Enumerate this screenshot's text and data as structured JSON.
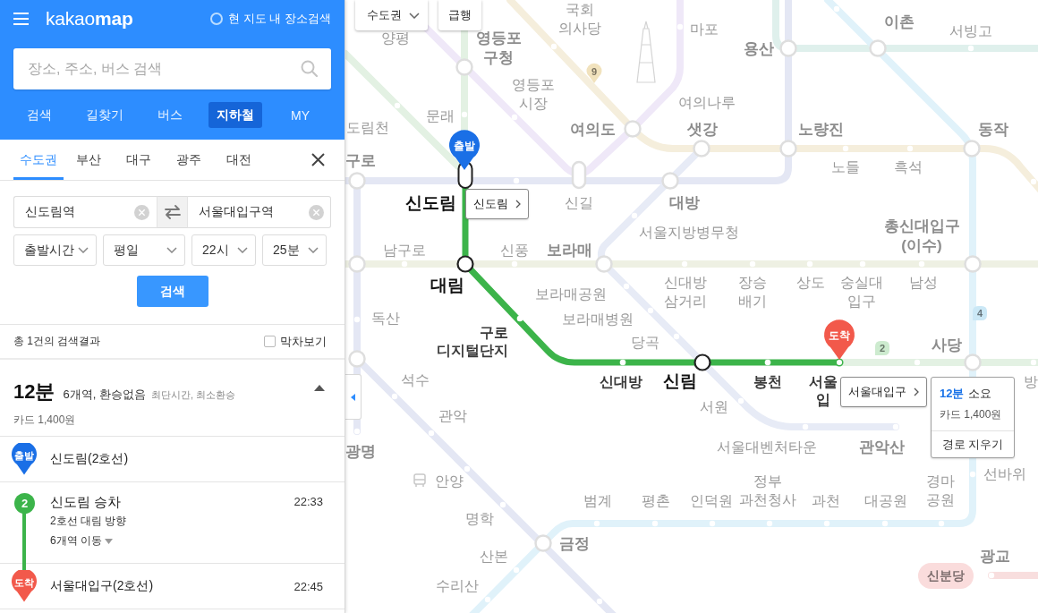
{
  "header": {
    "logo": "kakao**map**",
    "area_search": {
      "label": "현 지도 내 장소검색",
      "checked": false
    },
    "search": {
      "placeholder": "장소, 주소, 버스 검색"
    },
    "nav_tabs": [
      {
        "label": "검색",
        "selected": false
      },
      {
        "label": "길찾기",
        "selected": false
      },
      {
        "label": "버스",
        "selected": false
      },
      {
        "label": "지하철",
        "selected": true
      },
      {
        "label": "MY",
        "selected": false
      }
    ]
  },
  "region_tabs": [
    {
      "label": "수도권",
      "selected": true
    },
    {
      "label": "부산",
      "selected": false
    },
    {
      "label": "대구",
      "selected": false
    },
    {
      "label": "광주",
      "selected": false
    },
    {
      "label": "대전",
      "selected": false
    }
  ],
  "route_form": {
    "origin": "신도림역",
    "destination": "서울대입구역",
    "selects": [
      "출발시간",
      "평일",
      "22시",
      "25분"
    ],
    "search_button": "검색"
  },
  "results_bar": {
    "count": "총 1건의 검색결과",
    "last_train": {
      "label": "막차보기",
      "checked": false
    }
  },
  "result": {
    "duration": "12분",
    "summary": "6개역, 환승없음",
    "tags": "최단시간, 최소환승",
    "fare": "카드 1,400원",
    "expanded": true,
    "steps": [
      {
        "kind": "start",
        "badge": "출발",
        "title": "신도림(2호선)"
      },
      {
        "kind": "ride",
        "badge": "2",
        "title": "신도림 승차",
        "time": "22:33",
        "direction": "2호선 대림 방향",
        "stops": {
          "label": "6개역 이동",
          "expanded": false
        }
      },
      {
        "kind": "end",
        "badge": "도착",
        "title": "서울대입구(2호선)",
        "time": "22:45"
      }
    ]
  },
  "map": {
    "region_select": "수도권",
    "express_button": "급행",
    "labels": [
      {
        "text": "양평",
        "kind": "station"
      },
      {
        "text": "영등포 구청",
        "kind": "transfer"
      },
      {
        "text": "국회 의사당",
        "kind": "station"
      },
      {
        "text": "마포",
        "kind": "station"
      },
      {
        "text": "용산",
        "kind": "transfer"
      },
      {
        "text": "이촌",
        "kind": "transfer"
      },
      {
        "text": "서빙고",
        "kind": "station"
      },
      {
        "text": "도림천",
        "kind": "station"
      },
      {
        "text": "문래",
        "kind": "station"
      },
      {
        "text": "영등포 시장",
        "kind": "station"
      },
      {
        "text": "여의나루",
        "kind": "station"
      },
      {
        "text": "여의도",
        "kind": "transfer"
      },
      {
        "text": "샛강",
        "kind": "transfer"
      },
      {
        "text": "노량진",
        "kind": "transfer"
      },
      {
        "text": "동작",
        "kind": "transfer"
      },
      {
        "text": "구로",
        "kind": "transfer"
      },
      {
        "text": "노들",
        "kind": "station"
      },
      {
        "text": "흑석",
        "kind": "station"
      },
      {
        "text": "신도림",
        "kind": "route-major"
      },
      {
        "text": "신길",
        "kind": "station"
      },
      {
        "text": "대방",
        "kind": "transfer"
      },
      {
        "text": "남구로",
        "kind": "station"
      },
      {
        "text": "신풍",
        "kind": "station"
      },
      {
        "text": "보라매",
        "kind": "transfer"
      },
      {
        "text": "서울지방병무청",
        "kind": "station"
      },
      {
        "text": "총신대입구 (이수)",
        "kind": "transfer"
      },
      {
        "text": "대림",
        "kind": "route-major"
      },
      {
        "text": "보라매공원",
        "kind": "station"
      },
      {
        "text": "독산",
        "kind": "station"
      },
      {
        "text": "구로 디지털단지",
        "kind": "route"
      },
      {
        "text": "보라매병원",
        "kind": "station"
      },
      {
        "text": "신대방 삼거리",
        "kind": "station"
      },
      {
        "text": "장승 배기",
        "kind": "station"
      },
      {
        "text": "상도",
        "kind": "station"
      },
      {
        "text": "숭실대 입구",
        "kind": "station"
      },
      {
        "text": "남성",
        "kind": "station"
      },
      {
        "text": "당곡",
        "kind": "station"
      },
      {
        "text": "사당",
        "kind": "transfer"
      },
      {
        "text": "석수",
        "kind": "station"
      },
      {
        "text": "관악",
        "kind": "station"
      },
      {
        "text": "신대방",
        "kind": "route"
      },
      {
        "text": "신림",
        "kind": "route-major"
      },
      {
        "text": "서원",
        "kind": "station"
      },
      {
        "text": "봉천",
        "kind": "route"
      },
      {
        "text": "서울 입",
        "kind": "route"
      },
      {
        "text": "방",
        "kind": "station"
      },
      {
        "text": "광명",
        "kind": "transfer"
      },
      {
        "text": "서울대벤처타운",
        "kind": "station"
      },
      {
        "text": "관악산",
        "kind": "transfer"
      },
      {
        "text": "안양",
        "kind": "station"
      },
      {
        "text": "명학",
        "kind": "station"
      },
      {
        "text": "범계",
        "kind": "station"
      },
      {
        "text": "평촌",
        "kind": "station"
      },
      {
        "text": "인덕원",
        "kind": "station"
      },
      {
        "text": "정부 과천청사",
        "kind": "station"
      },
      {
        "text": "과천",
        "kind": "station"
      },
      {
        "text": "대공원",
        "kind": "station"
      },
      {
        "text": "경마 공원",
        "kind": "station"
      },
      {
        "text": "선바위",
        "kind": "station"
      },
      {
        "text": "산본",
        "kind": "station"
      },
      {
        "text": "금정",
        "kind": "transfer"
      },
      {
        "text": "광교",
        "kind": "transfer"
      },
      {
        "text": "수리산",
        "kind": "station"
      }
    ],
    "line_badges": [
      {
        "label": "9",
        "kind": "pin",
        "color": "#f1e2bd"
      },
      {
        "label": "2",
        "kind": "drop",
        "color": "#cdebcf"
      },
      {
        "label": "4",
        "kind": "drop",
        "color": "#cbe8f6"
      },
      {
        "label": "신분당",
        "kind": "pill",
        "color": "#fadcdc"
      }
    ],
    "markers": [
      {
        "kind": "start",
        "label": "출발"
      },
      {
        "kind": "end",
        "label": "도착"
      }
    ],
    "station_popups": [
      {
        "label": "신도림"
      },
      {
        "label": "서울대입구"
      }
    ],
    "route_info": {
      "duration": "12분",
      "suffix": "소요",
      "fare": "카드 1,400원",
      "clear_button": "경로 지우기"
    }
  }
}
